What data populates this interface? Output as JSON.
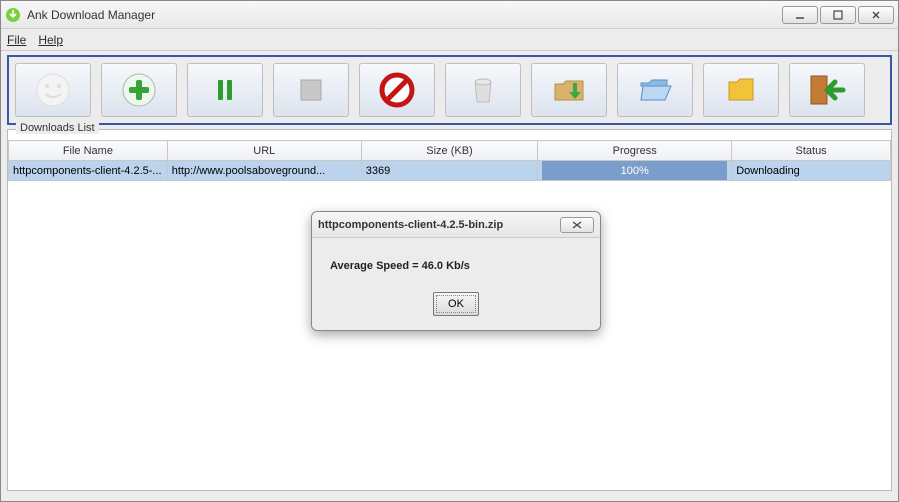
{
  "window": {
    "title": "Ank Download Manager"
  },
  "menu": {
    "file": "File",
    "help": "Help"
  },
  "toolbar": {
    "icons": {
      "smile": "smile-icon",
      "add": "add-icon",
      "pause": "pause-icon",
      "rect": "stop-icon",
      "cancel": "cancel-icon",
      "trash": "trash-icon",
      "folder_down": "download-folder-icon",
      "folder_open": "open-folder-icon",
      "folder_up": "export-folder-icon",
      "exit": "exit-icon"
    }
  },
  "downloads": {
    "group_label": "Downloads List",
    "columns": {
      "file": "File Name",
      "url": "URL",
      "size": "Size (KB)",
      "progress": "Progress",
      "status": "Status"
    },
    "rows": [
      {
        "file": "httpcomponents-client-4.2.5-...",
        "url": "http://www.poolsaboveground...",
        "size": "3369",
        "progress": "100%",
        "status": "Downloading"
      }
    ]
  },
  "dialog": {
    "title": "httpcomponents-client-4.2.5-bin.zip",
    "message": "Average Speed = 46.0 Kb/s",
    "ok": "OK"
  }
}
